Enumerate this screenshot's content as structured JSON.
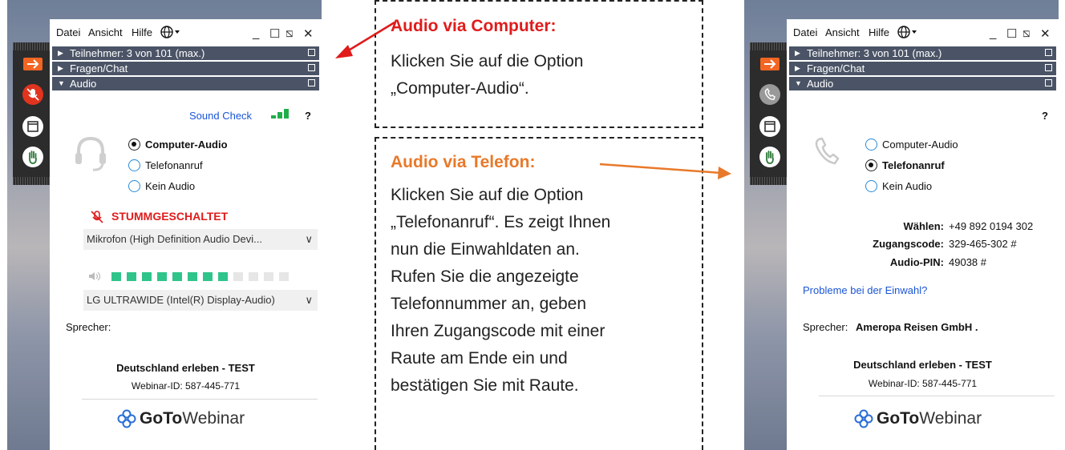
{
  "left_window": {
    "menu": {
      "file": "Datei",
      "view": "Ansicht",
      "help": "Hilfe",
      "globe_icon": "globe-icon"
    },
    "window_controls": {
      "minimize": "_",
      "maximize": "☐",
      "restore": "⧅",
      "close": "✕"
    },
    "sections": {
      "attendees": "Teilnehmer: 3 von 101 (max.)",
      "questions": "Fragen/Chat",
      "audio": "Audio"
    },
    "sound_check": "Sound Check",
    "help_mark": "?",
    "audio_options": [
      "Computer-Audio",
      "Telefonanruf",
      "Kein Audio"
    ],
    "selected_option": "Computer-Audio",
    "mute_status": "STUMMGESCHALTET",
    "microphone_select": "Mikrofon (High Definition Audio Devi...",
    "speaker_level": {
      "value": 8,
      "max": 12
    },
    "speaker_select": "LG ULTRAWIDE (Intel(R) Display-Audio)",
    "speaker_label": "Sprecher:",
    "webinar_title": "Deutschland erleben - TEST",
    "webinar_id": "Webinar-ID: 587-445-771",
    "brand": {
      "goto": "GoTo",
      "webinar": "Webinar"
    }
  },
  "callout_computer": {
    "title": "Audio via Computer:",
    "lines": [
      "Klicken Sie auf die Option",
      "„Computer-Audio“."
    ],
    "title_color": "#e01b1b"
  },
  "callout_phone": {
    "title": "Audio via Telefon:",
    "lines": [
      "Klicken Sie auf die Option",
      "„Telefonanruf“. Es zeigt Ihnen",
      "nun die Einwahldaten an.",
      "Rufen Sie die angezeigte",
      "Telefonnummer an, geben",
      "Ihren Zugangscode mit einer",
      "Raute am Ende ein und",
      "bestätigen Sie mit Raute."
    ],
    "title_color": "#e8792a"
  },
  "right_window": {
    "menu": {
      "file": "Datei",
      "view": "Ansicht",
      "help": "Hilfe"
    },
    "sections": {
      "attendees": "Teilnehmer: 3 von 101 (max.)",
      "questions": "Fragen/Chat",
      "audio": "Audio"
    },
    "help_mark": "?",
    "audio_options": [
      "Computer-Audio",
      "Telefonanruf",
      "Kein Audio"
    ],
    "selected_option": "Telefonanruf",
    "dial": {
      "dial_label": "Wählen:",
      "dial_value": "+49 892 0194 302",
      "access_label": "Zugangscode:",
      "access_value": "329-465-302 #",
      "pin_label": "Audio-PIN:",
      "pin_value": "49038 #"
    },
    "dial_help_link": "Probleme bei der Einwahl?",
    "speaker_label": "Sprecher:",
    "speaker_name": "Ameropa Reisen GmbH .",
    "webinar_title": "Deutschland erleben - TEST",
    "webinar_id": "Webinar-ID: 587-445-771",
    "brand": {
      "goto": "GoTo",
      "webinar": "Webinar"
    }
  },
  "colors": {
    "accent_orange": "#f26522",
    "link_blue": "#1a55d6",
    "level_green": "#2fc48a",
    "mute_red": "#e01b1b"
  }
}
